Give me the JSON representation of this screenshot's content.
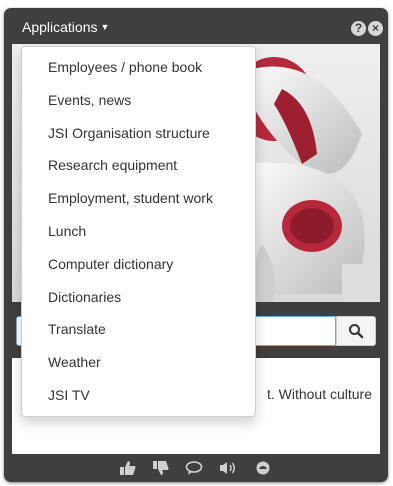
{
  "header": {
    "title": "Applications",
    "title_icon": "caret-down-icon",
    "buttons": [
      {
        "icon": "help-icon",
        "glyph": "?"
      },
      {
        "icon": "close-icon",
        "glyph": "×"
      }
    ]
  },
  "menu": {
    "items": [
      {
        "label": "Employees / phone book"
      },
      {
        "label": "Events, news"
      },
      {
        "label": "JSI Organisation structure"
      },
      {
        "label": "Research equipment"
      },
      {
        "label": "Employment, student work"
      },
      {
        "label": "Lunch"
      },
      {
        "label": "Computer dictionary"
      },
      {
        "label": "Dictionaries"
      },
      {
        "label": "Translate"
      },
      {
        "label": "Weather"
      },
      {
        "label": "JSI TV"
      }
    ]
  },
  "search": {
    "value": "",
    "button_icon": "search-icon"
  },
  "quote": {
    "visible_text": "t. Without culture"
  },
  "footer": {
    "icons": [
      "thumbs-up-icon",
      "thumbs-down-icon",
      "comment-icon",
      "volume-icon",
      "cloud-icon"
    ]
  },
  "colors": {
    "frame": "#3f3f3f",
    "robot_red": "#b8283c",
    "focus_border": "#66afe9"
  }
}
